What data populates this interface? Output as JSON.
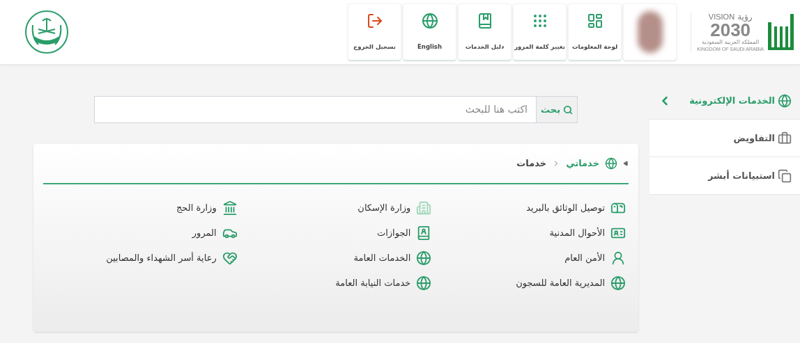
{
  "logo": {
    "vision_en": "VISION",
    "vision_ar": "رؤية",
    "year": "2030",
    "country_ar": "المملكة العربية السعودية",
    "country_en": "KINGDOM OF SAUDI ARABIA"
  },
  "toolbar": [
    {
      "kind": "avatar"
    },
    {
      "kind": "dashboard",
      "label": "لوحة المعلومات"
    },
    {
      "kind": "password",
      "label": "تغيير كلمة المرور"
    },
    {
      "kind": "guide",
      "label": "دليل الخدمات"
    },
    {
      "kind": "language",
      "label": "English"
    },
    {
      "kind": "logout",
      "label": "تسجيل الخروج"
    }
  ],
  "sidebar": {
    "items": [
      {
        "label": "الخدمات الإلكترونية",
        "selected": true
      },
      {
        "label": "التفاويض",
        "selected": false
      },
      {
        "label": "استبيانات أبشر",
        "selected": false
      }
    ]
  },
  "search": {
    "button": "بحث",
    "placeholder": "اكتب هنا للبحث"
  },
  "breadcrumb": [
    "خدماتي",
    "خدمات"
  ],
  "services": [
    [
      "توصيل الوثائق بالبريد",
      "الأحوال المدنية",
      "الأمن العام",
      "المديرية العامة للسجون"
    ],
    [
      "وزارة الإسكان",
      "الجوازات",
      "الخدمات العامة",
      "خدمات النيابة العامة"
    ],
    [
      "وزارة الحج",
      "المرور",
      "رعاية أسر الشهداء والمصابين"
    ]
  ]
}
